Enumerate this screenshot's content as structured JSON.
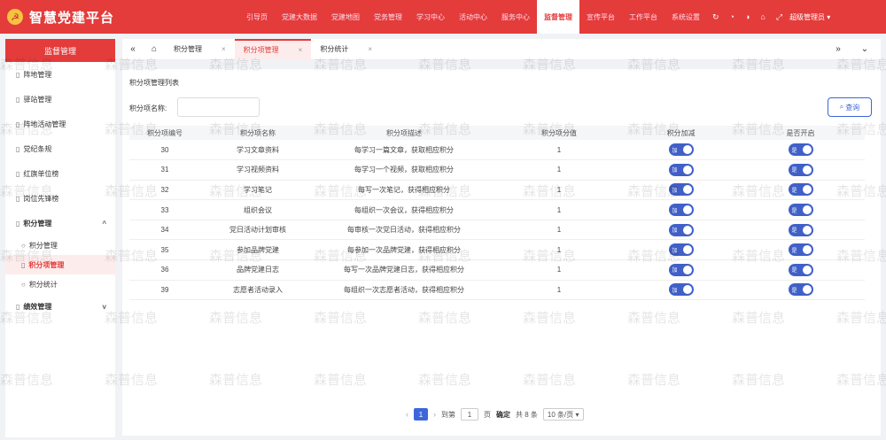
{
  "header": {
    "logo": "☭",
    "title": "智慧党建平台",
    "nav": [
      {
        "label": "引导页",
        "active": false
      },
      {
        "label": "党建大数据",
        "active": false
      },
      {
        "label": "党建地图",
        "active": false
      },
      {
        "label": "党务管理",
        "active": false
      },
      {
        "label": "学习中心",
        "active": false
      },
      {
        "label": "活动中心",
        "active": false
      },
      {
        "label": "服务中心",
        "active": false
      },
      {
        "label": "监督管理",
        "active": true
      },
      {
        "label": "宣传平台",
        "active": false
      },
      {
        "label": "工作平台",
        "active": false
      },
      {
        "label": "系统设置",
        "active": false
      }
    ],
    "user": "超级管理员 ▾"
  },
  "sidebar": {
    "title": "监督管理",
    "items": [
      "阵地管理",
      "驿站管理",
      "阵地活动管理",
      "党纪条规",
      "红旗单位榜",
      "岗位先锋榜"
    ],
    "group": {
      "label": "积分管理",
      "chevron": "^"
    },
    "subitems": [
      {
        "label": "积分管理",
        "active": false
      },
      {
        "label": "积分项管理",
        "active": true
      },
      {
        "label": "积分统计",
        "active": false
      }
    ],
    "group2": {
      "label": "绩效管理",
      "chevron": "v"
    }
  },
  "tabs": [
    {
      "label": "积分管理",
      "active": false
    },
    {
      "label": "积分项管理",
      "active": true
    },
    {
      "label": "积分统计",
      "active": false
    }
  ],
  "main": {
    "title": "积分项管理列表",
    "filter_label": "积分项名称:",
    "filter_placeholder": "",
    "search_label": "查询"
  },
  "table": {
    "columns": [
      "积分项编号",
      "积分项名称",
      "积分项描述",
      "积分项分值",
      "积分加减",
      "是否开启"
    ],
    "rows": [
      {
        "id": "30",
        "name": "学习文章资料",
        "desc": "每学习一篇文章，获取相应积分",
        "score": "1",
        "sign": "加",
        "enabled": "是"
      },
      {
        "id": "31",
        "name": "学习视频资料",
        "desc": "每学习一个视频，获取相应积分",
        "score": "1",
        "sign": "加",
        "enabled": "是"
      },
      {
        "id": "32",
        "name": "学习笔记",
        "desc": "每写一次笔记，获得相应积分",
        "score": "1",
        "sign": "加",
        "enabled": "是"
      },
      {
        "id": "33",
        "name": "组织会议",
        "desc": "每组织一次会议，获得相应积分",
        "score": "1",
        "sign": "加",
        "enabled": "是"
      },
      {
        "id": "34",
        "name": "党日活动计划审核",
        "desc": "每审核一次党日活动，获得相应积分",
        "score": "1",
        "sign": "加",
        "enabled": "是"
      },
      {
        "id": "35",
        "name": "参加品牌党建",
        "desc": "每参加一次品牌党建，获得相应积分",
        "score": "1",
        "sign": "加",
        "enabled": "是"
      },
      {
        "id": "36",
        "name": "品牌党建日志",
        "desc": "每写一次品牌党建日志，获得相应积分",
        "score": "1",
        "sign": "加",
        "enabled": "是"
      },
      {
        "id": "39",
        "name": "志愿者活动录入",
        "desc": "每组织一次志愿者活动，获得相应积分",
        "score": "1",
        "sign": "加",
        "enabled": "是"
      }
    ]
  },
  "pager": {
    "prev": "‹",
    "current": "1",
    "next": "›",
    "goto_prefix": "到第",
    "goto_value": "1",
    "goto_suffix": "页",
    "confirm": "确定",
    "total": "共 8 条",
    "page_size": "10 条/页 ▾"
  },
  "watermark": "森普信息",
  "colors": {
    "brand_red": "#e43b3b",
    "toggle_blue": "#4060c8",
    "link_blue": "#3d66d9"
  }
}
